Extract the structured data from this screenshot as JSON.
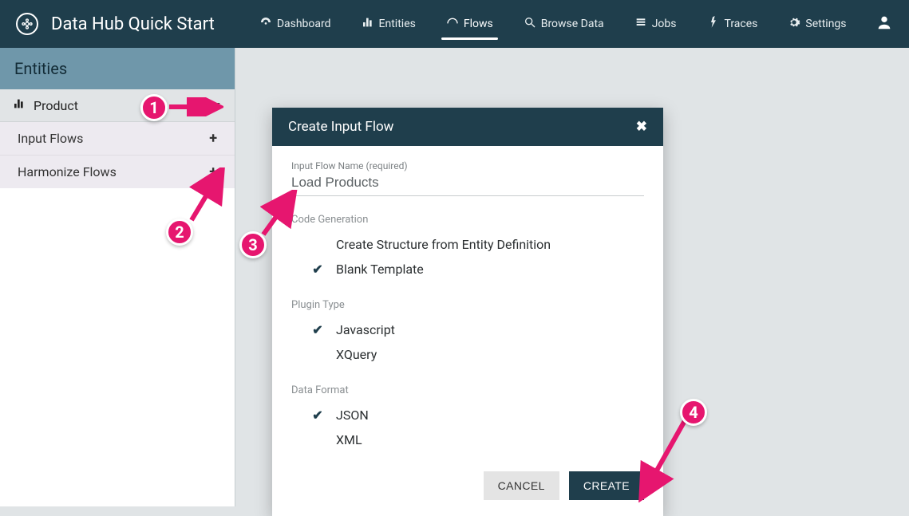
{
  "app": {
    "title": "Data Hub Quick Start"
  },
  "nav": {
    "items": [
      {
        "label": "Dashboard"
      },
      {
        "label": "Entities"
      },
      {
        "label": "Flows"
      },
      {
        "label": "Browse Data"
      },
      {
        "label": "Jobs"
      },
      {
        "label": "Traces"
      },
      {
        "label": "Settings"
      }
    ]
  },
  "sidebar": {
    "header": "Entities",
    "entity": {
      "name": "Product"
    },
    "flows": [
      {
        "label": "Input Flows"
      },
      {
        "label": "Harmonize Flows"
      }
    ]
  },
  "modal": {
    "title": "Create Input Flow",
    "name_label": "Input Flow Name (required)",
    "name_value": "Load Products",
    "codegen_label": "Code Generation",
    "codegen_options": [
      {
        "label": "Create Structure from Entity Definition",
        "checked": false
      },
      {
        "label": "Blank Template",
        "checked": true
      }
    ],
    "plugin_label": "Plugin Type",
    "plugin_options": [
      {
        "label": "Javascript",
        "checked": true
      },
      {
        "label": "XQuery",
        "checked": false
      }
    ],
    "format_label": "Data Format",
    "format_options": [
      {
        "label": "JSON",
        "checked": true
      },
      {
        "label": "XML",
        "checked": false
      }
    ],
    "cancel": "CANCEL",
    "create": "CREATE"
  },
  "annotations": {
    "b1": "1",
    "b2": "2",
    "b3": "3",
    "b4": "4"
  }
}
